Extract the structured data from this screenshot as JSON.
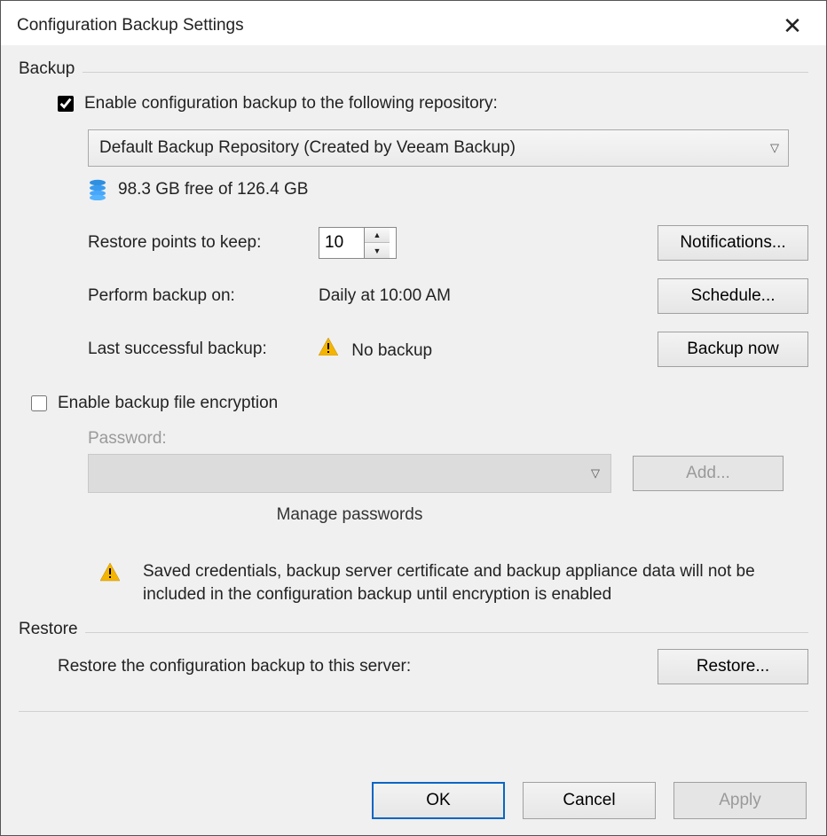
{
  "window": {
    "title": "Configuration Backup Settings"
  },
  "backup": {
    "legend": "Backup",
    "enable_label": "Enable configuration backup to the following repository:",
    "enable_checked": true,
    "repo_selected": "Default Backup Repository (Created by Veeam Backup)",
    "free_space": "98.3 GB free of 126.4 GB",
    "restore_points_label": "Restore points to keep:",
    "restore_points_value": "10",
    "notifications_btn": "Notifications...",
    "perform_label": "Perform backup on:",
    "perform_value": "Daily at 10:00 AM",
    "schedule_btn": "Schedule...",
    "last_label": "Last successful backup:",
    "last_value": "No backup",
    "backup_now_btn": "Backup now",
    "encrypt_enable_label": "Enable backup file encryption",
    "encrypt_enable_checked": false,
    "password_label": "Password:",
    "add_btn": "Add...",
    "manage_passwords": "Manage passwords",
    "warning_text": "Saved credentials, backup server certificate and backup appliance data will not be included in the configuration backup until encryption is enabled"
  },
  "restore": {
    "legend": "Restore",
    "text": "Restore the configuration backup to this server:",
    "restore_btn": "Restore..."
  },
  "footer": {
    "ok": "OK",
    "cancel": "Cancel",
    "apply": "Apply"
  }
}
